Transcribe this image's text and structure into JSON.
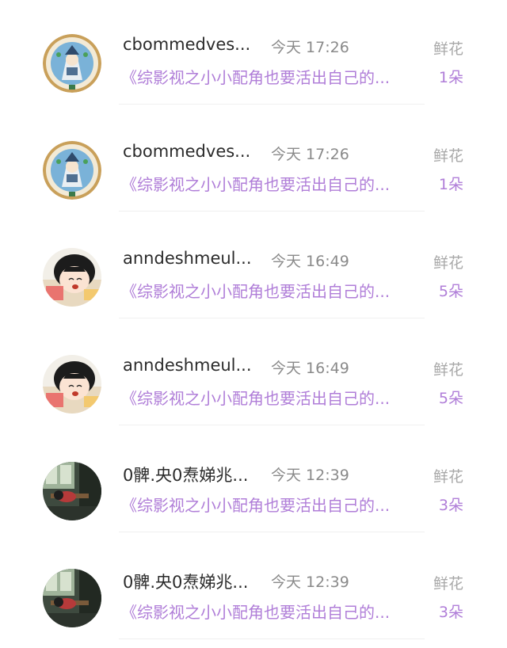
{
  "gift_list": [
    {
      "name": "cbommedves...",
      "time": "今天 17:26",
      "gift_label": "鲜花",
      "book_title": "《综影视之小小配角也要活出自己的...",
      "count": "1朵",
      "avatar": "anime-warrior-badge-avatar"
    },
    {
      "name": "cbommedves...",
      "time": "今天 17:26",
      "gift_label": "鲜花",
      "book_title": "《综影视之小小配角也要活出自己的...",
      "count": "1朵",
      "avatar": "anime-warrior-badge-avatar"
    },
    {
      "name": "anndeshmeul...",
      "time": "今天 16:49",
      "gift_label": "鲜花",
      "book_title": "《综影视之小小配角也要活出自己的...",
      "count": "5朵",
      "avatar": "cartoon-girl-avatar"
    },
    {
      "name": "anndeshmeul...",
      "time": "今天 16:49",
      "gift_label": "鲜花",
      "book_title": "《综影视之小小配角也要活出自己的...",
      "count": "5朵",
      "avatar": "cartoon-girl-avatar"
    },
    {
      "name": "0髀.央0焘娣兆...",
      "time": "今天 12:39",
      "gift_label": "鲜花",
      "book_title": "《综影视之小小配角也要活出自己的...",
      "count": "3朵",
      "avatar": "classroom-photo-avatar"
    },
    {
      "name": "0髀.央0焘娣兆...",
      "time": "今天 12:39",
      "gift_label": "鲜花",
      "book_title": "《综影视之小小配角也要活出自己的...",
      "count": "3朵",
      "avatar": "classroom-photo-avatar"
    }
  ],
  "colors": {
    "accent": "#b07ed8",
    "name": "#2b2b2b",
    "time": "#8a8a8a",
    "label": "#a8a8a8"
  }
}
